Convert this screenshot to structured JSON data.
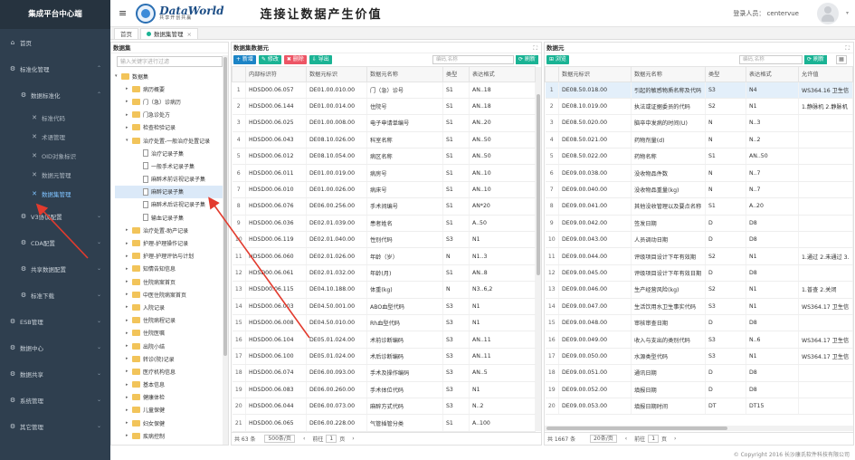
{
  "app_title": "集成平台中心端",
  "sidebar": {
    "items": [
      {
        "label": "首页",
        "icon": "home-icon",
        "level": 0
      },
      {
        "label": "标准化管理",
        "icon": "gear-icon",
        "level": 0,
        "chev": "⌃"
      },
      {
        "label": "数据标准化",
        "icon": "gear-icon",
        "level": 1,
        "chev": "⌃"
      },
      {
        "label": "标准代码",
        "icon": "tool-icon",
        "level": 2
      },
      {
        "label": "术语管理",
        "icon": "tool-icon",
        "level": 2
      },
      {
        "label": "OID对象标识",
        "icon": "tool-icon",
        "level": 2
      },
      {
        "label": "数据元管理",
        "icon": "tool-icon",
        "level": 2
      },
      {
        "label": "数据集管理",
        "icon": "tool-icon",
        "level": 2,
        "active": true
      },
      {
        "label": "V3协议配置",
        "icon": "gear-icon",
        "level": 1,
        "chev": "⌄"
      },
      {
        "label": "CDA配置",
        "icon": "gear-icon",
        "level": 1,
        "chev": "⌄"
      },
      {
        "label": "共享数据配置",
        "icon": "gear-icon",
        "level": 1,
        "chev": "⌄"
      },
      {
        "label": "标准下载",
        "icon": "gear-icon",
        "level": 1,
        "chev": "⌄"
      },
      {
        "label": "ESB管理",
        "icon": "gear-icon",
        "level": 0,
        "chev": "⌄"
      },
      {
        "label": "数据中心",
        "icon": "gear-icon",
        "level": 0,
        "chev": "⌄"
      },
      {
        "label": "数据共享",
        "icon": "gear-icon",
        "level": 0,
        "chev": "⌄"
      },
      {
        "label": "系统管理",
        "icon": "gear-icon",
        "level": 0,
        "chev": "⌄"
      },
      {
        "label": "其它管理",
        "icon": "gear-icon",
        "level": 0,
        "chev": "⌄"
      }
    ]
  },
  "header": {
    "hamburger": "≡",
    "logo_main": "DataWorld",
    "logo_sub": "共享开创共赢",
    "slogan": "连接让数据产生价值",
    "user_label": "登录人员： centervue",
    "avatar_caret": "▾"
  },
  "tabs": {
    "home": "首页",
    "active": "数据集管理",
    "close": "×"
  },
  "tree_panel": {
    "title": "数据集",
    "search_placeholder": "输入关键字进行过滤",
    "nodes": [
      {
        "label": "数据集",
        "depth": 0,
        "type": "folder",
        "arrow": "▾"
      },
      {
        "label": "病历概要",
        "depth": 1,
        "type": "folder",
        "arrow": "▸"
      },
      {
        "label": "门（急）诊病历",
        "depth": 1,
        "type": "folder",
        "arrow": "▸"
      },
      {
        "label": "门急诊处方",
        "depth": 1,
        "type": "folder",
        "arrow": "▸"
      },
      {
        "label": "检查检验记录",
        "depth": 1,
        "type": "folder",
        "arrow": "▸"
      },
      {
        "label": "治疗处置-一般治疗处置记录",
        "depth": 1,
        "type": "folder",
        "arrow": "▾"
      },
      {
        "label": "治疗记录子集",
        "depth": 2,
        "type": "file"
      },
      {
        "label": "一般手术记录子集",
        "depth": 2,
        "type": "file"
      },
      {
        "label": "麻醉术前访视记录子集",
        "depth": 2,
        "type": "file"
      },
      {
        "label": "麻醉记录子集",
        "depth": 2,
        "type": "file",
        "selected": true
      },
      {
        "label": "麻醉术后访视记录子集",
        "depth": 2,
        "type": "file"
      },
      {
        "label": "输血记录子集",
        "depth": 2,
        "type": "file"
      },
      {
        "label": "治疗处置-助产记录",
        "depth": 1,
        "type": "folder",
        "arrow": "▸"
      },
      {
        "label": "护理-护理操作记录",
        "depth": 1,
        "type": "folder",
        "arrow": "▸"
      },
      {
        "label": "护理-护理评估与计划",
        "depth": 1,
        "type": "folder",
        "arrow": "▸"
      },
      {
        "label": "知情告知信息",
        "depth": 1,
        "type": "folder",
        "arrow": "▸"
      },
      {
        "label": "住院病案首页",
        "depth": 1,
        "type": "folder",
        "arrow": "▸"
      },
      {
        "label": "中医住院病案首页",
        "depth": 1,
        "type": "folder",
        "arrow": "▸"
      },
      {
        "label": "入院记录",
        "depth": 1,
        "type": "folder",
        "arrow": "▸"
      },
      {
        "label": "住院病程记录",
        "depth": 1,
        "type": "folder",
        "arrow": "▸"
      },
      {
        "label": "住院医嘱",
        "depth": 1,
        "type": "folder",
        "arrow": "▸"
      },
      {
        "label": "出院小结",
        "depth": 1,
        "type": "folder",
        "arrow": "▸"
      },
      {
        "label": "转诊(院)记录",
        "depth": 1,
        "type": "folder",
        "arrow": "▸"
      },
      {
        "label": "医疗机构信息",
        "depth": 1,
        "type": "folder",
        "arrow": "▸"
      },
      {
        "label": "基本信息",
        "depth": 1,
        "type": "folder",
        "arrow": "▸"
      },
      {
        "label": "健康体检",
        "depth": 1,
        "type": "folder",
        "arrow": "▸"
      },
      {
        "label": "儿童保健",
        "depth": 1,
        "type": "folder",
        "arrow": "▸"
      },
      {
        "label": "妇女保健",
        "depth": 1,
        "type": "folder",
        "arrow": "▸"
      },
      {
        "label": "疾病控制",
        "depth": 1,
        "type": "folder",
        "arrow": "▸"
      }
    ]
  },
  "mid_panel": {
    "title": "数据集数据元",
    "expand": "⛶",
    "buttons": {
      "add": "+ 新增",
      "edit": "✎ 修改",
      "delete": "✖ 删除",
      "export": "⇩ 导出"
    },
    "search_placeholder": "编码,名称",
    "refresh": "⟳ 刷新",
    "columns": [
      "",
      "内部标识符",
      "数据元标识",
      "数据元名称",
      "类型",
      "表达格式"
    ],
    "rows": [
      [
        "1",
        "HDSD00.06.057",
        "DE01.00.010.00",
        "门（急）诊号",
        "S1",
        "AN..18"
      ],
      [
        "2",
        "HDSD00.06.144",
        "DE01.00.014.00",
        "住院号",
        "S1",
        "AN..18"
      ],
      [
        "3",
        "HDSD00.06.025",
        "DE01.00.008.00",
        "电子申请单编号",
        "S1",
        "AN..20"
      ],
      [
        "4",
        "HDSD00.06.043",
        "DE08.10.026.00",
        "科室名称",
        "S1",
        "AN..50"
      ],
      [
        "5",
        "HDSD00.06.012",
        "DE08.10.054.00",
        "病区名称",
        "S1",
        "AN..50"
      ],
      [
        "6",
        "HDSD00.06.011",
        "DE01.00.019.00",
        "病房号",
        "S1",
        "AN..10"
      ],
      [
        "7",
        "HDSD00.06.010",
        "DE01.00.026.00",
        "病床号",
        "S1",
        "AN..10"
      ],
      [
        "8",
        "HDSD00.06.076",
        "DE06.00.256.00",
        "手术间编号",
        "S1",
        "AN*20"
      ],
      [
        "9",
        "HDSD00.06.036",
        "DE02.01.039.00",
        "患者姓名",
        "S1",
        "A..50"
      ],
      [
        "10",
        "HDSD00.06.119",
        "DE02.01.040.00",
        "性别代码",
        "S3",
        "N1"
      ],
      [
        "11",
        "HDSD00.06.060",
        "DE02.01.026.00",
        "年龄（岁）",
        "N",
        "N1..3"
      ],
      [
        "12",
        "HDSD00.06.061",
        "DE02.01.032.00",
        "年龄(月)",
        "S1",
        "AN..8"
      ],
      [
        "13",
        "HDSD00.06.115",
        "DE04.10.188.00",
        "体重(kg)",
        "N",
        "N3..6,2"
      ],
      [
        "14",
        "HDSD00.06.003",
        "DE04.50.001.00",
        "ABO血型代码",
        "S3",
        "N1"
      ],
      [
        "15",
        "HDSD00.06.008",
        "DE04.50.010.00",
        "Rh血型代码",
        "S3",
        "N1"
      ],
      [
        "16",
        "HDSD00.06.104",
        "DE05.01.024.00",
        "术前诊断编码",
        "S3",
        "AN..11"
      ],
      [
        "17",
        "HDSD00.06.100",
        "DE05.01.024.00",
        "术后诊断编码",
        "S3",
        "AN..11"
      ],
      [
        "18",
        "HDSD00.06.074",
        "DE06.00.093.00",
        "手术及操作编码",
        "S3",
        "AN..5"
      ],
      [
        "19",
        "HDSD00.06.083",
        "DE06.00.260.00",
        "手术体位代码",
        "S3",
        "N1"
      ],
      [
        "20",
        "HDSD00.06.044",
        "DE06.00.073.00",
        "麻醉方式代码",
        "S3",
        "N..2"
      ],
      [
        "21",
        "HDSD00.06.065",
        "DE06.00.228.00",
        "气管插管分类",
        "S1",
        "A..100"
      ]
    ],
    "pager": {
      "total": "共 63 条",
      "size": "500条/页",
      "prev": "‹",
      "goto": "前往",
      "page": "1",
      "unit": "页",
      "next": "›"
    }
  },
  "right_panel": {
    "title": "数据元",
    "expand": "⛶",
    "buttons": {
      "browse": "⊞ 浏览"
    },
    "search_placeholder": "编码,名称",
    "refresh": "⟳ 刷新",
    "grid_icon": "▦",
    "columns": [
      "",
      "数据元标识",
      "数据元名称",
      "类型",
      "表达格式",
      "允许值"
    ],
    "rows": [
      [
        "1",
        "DE08.50.018.00",
        "引起的敏感物质名称及代码",
        "S3",
        "N4",
        "WS364.16 卫生信"
      ],
      [
        "2",
        "DE08.10.019.00",
        "执法或证据委员的代码",
        "S2",
        "N1",
        "1.静脉机 2.静脉机"
      ],
      [
        "3",
        "DE08.50.020.00",
        "脑卒中发病的时间(U)",
        "N",
        "N..3",
        ""
      ],
      [
        "4",
        "DE08.50.021.00",
        "药物剂量(d)",
        "N",
        "N..2",
        ""
      ],
      [
        "5",
        "DE08.50.022.00",
        "药物名称",
        "S1",
        "AN..50",
        ""
      ],
      [
        "6",
        "DE09.00.038.00",
        "没收物品件数",
        "N",
        "N..7",
        ""
      ],
      [
        "7",
        "DE09.00.040.00",
        "没收物品重量(kg)",
        "N",
        "N..7",
        ""
      ],
      [
        "8",
        "DE09.00.041.00",
        "其他没收管理以及要点名称",
        "S1",
        "A..20",
        ""
      ],
      [
        "9",
        "DE09.00.042.00",
        "签发日期",
        "D",
        "D8",
        ""
      ],
      [
        "10",
        "DE09.00.043.00",
        "人员调动日期",
        "D",
        "D8",
        ""
      ],
      [
        "11",
        "DE09.00.044.00",
        "评级项目设计下年有效期",
        "S2",
        "N1",
        "1.通过 2.未通过 3."
      ],
      [
        "12",
        "DE09.00.045.00",
        "评级项目设计下年有效日期",
        "D",
        "D8",
        ""
      ],
      [
        "13",
        "DE09.00.046.00",
        "生产经营风险(kg)",
        "S2",
        "N1",
        "1.普查 2.关闭"
      ],
      [
        "14",
        "DE09.00.047.00",
        "生活饮用水卫生事实代码",
        "S3",
        "N1",
        "WS364.17 卫生信"
      ],
      [
        "15",
        "DE09.00.048.00",
        "审核审查日期",
        "D",
        "D8",
        ""
      ],
      [
        "16",
        "DE09.00.049.00",
        "收入与支出的类别代码",
        "S3",
        "N..6",
        "WS364.17 卫生信"
      ],
      [
        "17",
        "DE09.00.050.00",
        "水源类型代码",
        "S3",
        "N1",
        "WS364.17 卫生信"
      ],
      [
        "18",
        "DE09.00.051.00",
        "通讯日期",
        "D",
        "D8",
        ""
      ],
      [
        "19",
        "DE09.00.052.00",
        "填报日期",
        "D",
        "D8",
        ""
      ],
      [
        "20",
        "DE09.00.053.00",
        "填报日期时间",
        "DT",
        "DT15",
        ""
      ]
    ],
    "pager": {
      "total": "共 1667 条",
      "size": "20条/页",
      "prev": "‹",
      "goto": "前往",
      "page": "1",
      "unit": "页",
      "next": "›"
    }
  },
  "copyright": "© Copyright 2016 长沙康氏软件科技有限公司",
  "colors": {
    "sidebar": "#2f3f4f",
    "accent": "#1ab394",
    "primary": "#1c84c6",
    "danger": "#ed5565",
    "arrow": "#e23b2e"
  }
}
